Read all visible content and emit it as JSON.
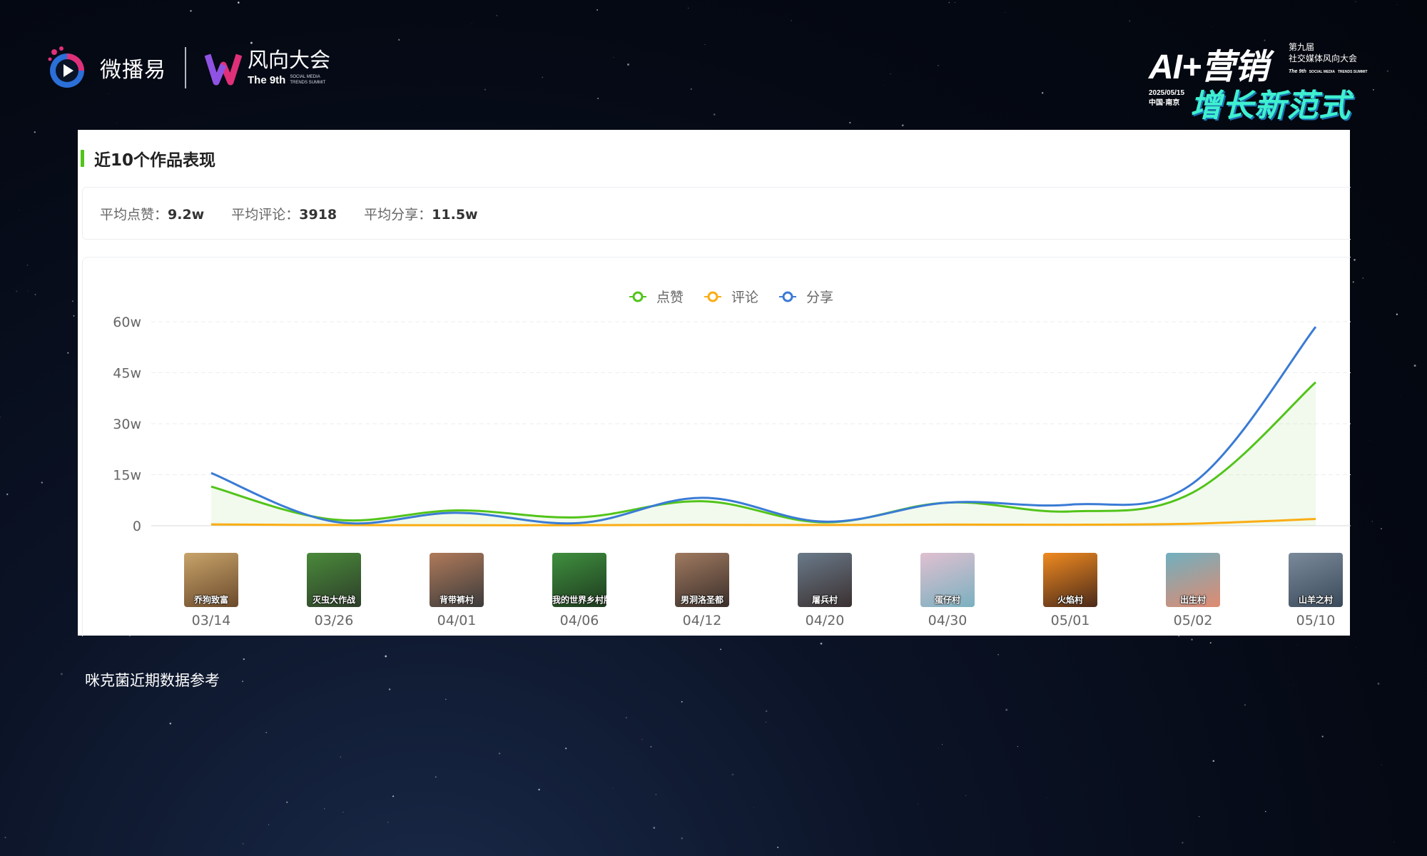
{
  "header": {
    "left_brand": "微播易",
    "summit_name": "风向大会",
    "summit_edition": "The 9th",
    "summit_sub": [
      "SOCIAL MEDIA",
      "TRENDS SUMMIT"
    ],
    "event_title": "AI+营销",
    "event_side": [
      "第九届",
      "社交媒体风向大会"
    ],
    "event_side_en": [
      "The 9th",
      "SOCIAL MEDIA",
      "TRENDS SUMMIT"
    ],
    "event_date": "2025/05/15",
    "event_city": "中国·南京",
    "event_slogan": "增长新范式",
    "colors": {
      "slogan": "#3ff0d0",
      "brand_pink": "#e0307a",
      "brand_blue": "#2b6fd8"
    }
  },
  "panel": {
    "title": "近10个作品表现",
    "stats": [
      {
        "label": "平均点赞：",
        "value": "9.2w"
      },
      {
        "label": "平均评论：",
        "value": "3918"
      },
      {
        "label": "平均分享：",
        "value": "11.5w"
      }
    ]
  },
  "chart_data": {
    "type": "line",
    "title": "",
    "xlabel": "",
    "ylabel": "",
    "categories": [
      "03/14",
      "03/26",
      "04/01",
      "04/06",
      "04/12",
      "04/20",
      "04/30",
      "05/01",
      "05/02",
      "05/10"
    ],
    "thumbnail_captions": [
      "乔狗致富",
      "灭虫大作战",
      "背带裤村",
      "我的世界乡村版",
      "男洞洛圣都",
      "屠兵村",
      "蛋仔村",
      "火焰村",
      "出生村",
      "山羊之村"
    ],
    "series": [
      {
        "name": "点赞",
        "color": "#52c41a",
        "area": true,
        "values": [
          115000,
          18000,
          45000,
          25000,
          72000,
          10000,
          68000,
          42000,
          98000,
          422000
        ]
      },
      {
        "name": "评论",
        "color": "#faad14",
        "area": false,
        "values": [
          4000,
          2000,
          1500,
          1500,
          2500,
          2000,
          3500,
          3000,
          6000,
          20000
        ]
      },
      {
        "name": "分享",
        "color": "#3a7bd5",
        "area": false,
        "values": [
          155000,
          12000,
          38000,
          8000,
          82000,
          12000,
          68000,
          62000,
          125000,
          585000
        ]
      }
    ],
    "yticks": [
      0,
      150000,
      300000,
      450000,
      600000
    ],
    "ytick_labels": [
      "0",
      "15w",
      "30w",
      "45w",
      "60w"
    ],
    "ylim": [
      0,
      600000
    ],
    "grid": true,
    "legend": "top-center"
  },
  "footnote": "咪克菌近期数据参考"
}
